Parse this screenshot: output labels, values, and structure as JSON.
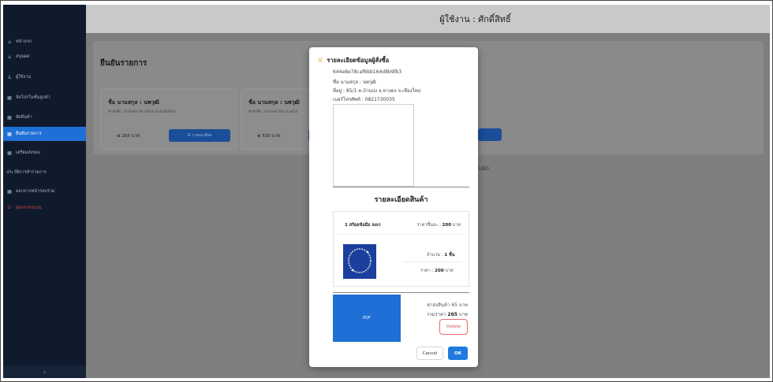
{
  "header": {
    "title": "ผู้ใช้งาน : ศักดิ์สิทธิ์"
  },
  "sidebar": {
    "items": [
      {
        "label": "หน้าแรก",
        "icon": "home-icon"
      },
      {
        "label": "สนุนผล",
        "icon": "home-icon"
      },
      {
        "label": "ผู้ใช้งาน",
        "icon": "user-icon"
      },
      {
        "label": "จัดโปรโมชั่นลูกค้า",
        "icon": "grid-icon"
      },
      {
        "label": "จัดสินค้า",
        "icon": "grid-icon"
      },
      {
        "label": "ยืนยันรายการ",
        "icon": "grid-icon"
      },
      {
        "label": "เตรียมส่งของ",
        "icon": "grid-icon"
      },
      {
        "label": "ประวัติการทำรายการ",
        "icon": ""
      },
      {
        "label": "ออกจากหน้ารอบร่วม",
        "icon": "grid-icon"
      },
      {
        "label": "ออกจากระบบ",
        "icon": "power-icon"
      }
    ],
    "collapse_glyph": "‹"
  },
  "main": {
    "title": "ยืนยันรายการ",
    "cards": [
      {
        "name": "ชื่อ นามสกุล : นพวุฒิ",
        "order_id": "คำสั่งซื้อ : 644e8e78caf6bb164d8b9fb3",
        "price": "265 บาท",
        "detail_label": "รายละเอียด",
        "price_icon": "coin-icon",
        "detail_icon": "list-icon"
      },
      {
        "name": "ชื่อ นามสกุล : นพวุฒิ",
        "order_id": "คำสั่งซื้อ : 644e8e76cc1ab2d",
        "price": "530 บาท",
        "price_icon": "coin-icon"
      }
    ],
    "fragment_text": "UED"
  },
  "modal": {
    "title": "รายละเอียดข้อมูลผู้สั่งซื้อ",
    "title_icon": "list-icon",
    "order_id": "644e8e78caf6bb164d8b9fb3",
    "name": "ชื่อ นามสกุล : นพวุฒิ",
    "address": "ที่อยู่ : 85/1 ต.บ้านปง อ.หางดง จ.เชียงใหม่",
    "phone": "เบอร์โทรศัพท์ : 0821730035",
    "products_title": "รายละเอียดสินค้า",
    "product": {
      "name": "1 สร้อยข้อมือ ลงเก",
      "unit_price_label": "ราคาชิ้นละ :",
      "unit_price_value": "200",
      "unit_price_suffix": "บาท",
      "qty_label": "จำนวน :",
      "qty_value": "1 ชิ้น",
      "total_label": "ราคา :",
      "total_value": "200",
      "total_suffix": "บาท"
    },
    "pdf_label": "PDF",
    "shipping": "ค่าส่งสินค้า 65 บาท",
    "grand_total_label": "รวมราคา",
    "grand_total_value": "265",
    "grand_total_suffix": "บาท",
    "delete_label": "Delete",
    "cancel_label": "Cancel",
    "ok_label": "OK"
  }
}
